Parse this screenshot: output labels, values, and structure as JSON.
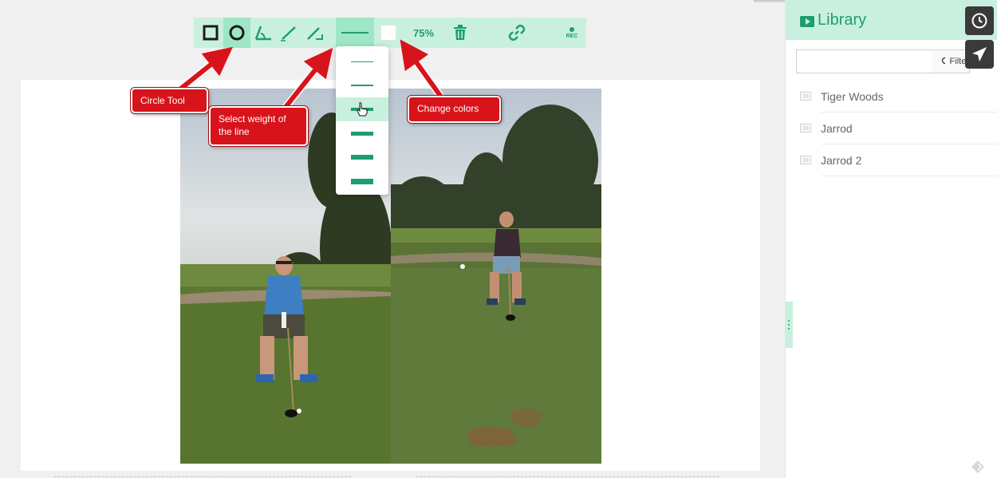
{
  "toolbar": {
    "tools": [
      {
        "name": "rectangle-tool",
        "icon": "square-icon"
      },
      {
        "name": "circle-tool",
        "icon": "circle-icon",
        "active": true
      },
      {
        "name": "angle-tool",
        "icon": "angle-icon"
      },
      {
        "name": "line-tool",
        "icon": "line-icon"
      },
      {
        "name": "arrow-tool",
        "icon": "arrow-line-icon"
      },
      {
        "name": "line-weight-tool",
        "icon": "line-weight-icon",
        "active": true
      }
    ],
    "color_swatch": "#ffffff",
    "zoom_label": "75%",
    "delete_icon": "trash-icon",
    "link_icon": "link-icon",
    "rec_label": "REC"
  },
  "weight_dropdown": {
    "weights": [
      1,
      2,
      4,
      5,
      6,
      7
    ],
    "highlighted_index": 2
  },
  "annotations": {
    "circle_tool": "Circle Tool",
    "line_weight_1": "Select weight of",
    "line_weight_2": "the line",
    "change_colors": "Change colors"
  },
  "library": {
    "title": "Library",
    "search_placeholder": "",
    "filter_label": "Filter",
    "items": [
      {
        "name": "Tiger Woods"
      },
      {
        "name": "Jarrod"
      },
      {
        "name": "Jarrod 2"
      }
    ]
  },
  "colors": {
    "accent": "#1e9e6f",
    "accent_light": "#c9f0df",
    "callout": "#d7141b"
  }
}
